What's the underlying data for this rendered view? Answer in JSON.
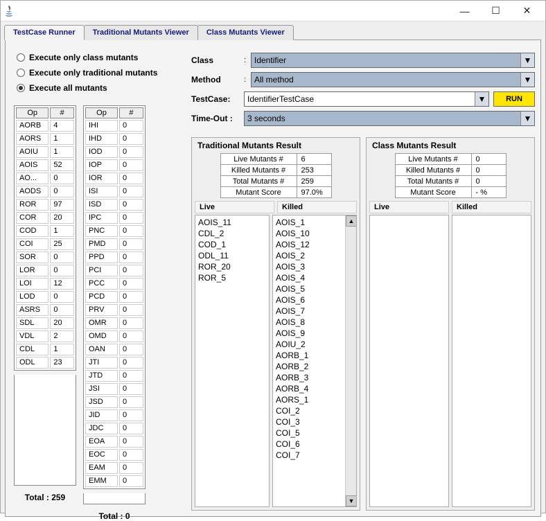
{
  "titlebar": {
    "title": ""
  },
  "tabs": [
    {
      "label": "TestCase Runner",
      "active": true
    },
    {
      "label": "Traditional Mutants Viewer",
      "active": false
    },
    {
      "label": "Class Mutants Viewer",
      "active": false
    }
  ],
  "radios": [
    {
      "label": "Execute only class mutants",
      "checked": false
    },
    {
      "label": "Execute only traditional mutants",
      "checked": false
    },
    {
      "label": "Execute all mutants",
      "checked": true
    }
  ],
  "form": {
    "class_label": "Class",
    "class_value": "Identifier",
    "method_label": "Method",
    "method_value": "All method",
    "testcase_label": "TestCase:",
    "testcase_value": "IdentifierTestCase",
    "run_label": "RUN",
    "timeout_label": "Time-Out :",
    "timeout_value": "3 seconds"
  },
  "op_header": {
    "op": "Op",
    "num": "#"
  },
  "op_left": [
    {
      "op": "AORB",
      "n": "4"
    },
    {
      "op": "AORS",
      "n": "1"
    },
    {
      "op": "AOIU",
      "n": "1"
    },
    {
      "op": "AOIS",
      "n": "52"
    },
    {
      "op": "AO...",
      "n": "0"
    },
    {
      "op": "AODS",
      "n": "0"
    },
    {
      "op": "ROR",
      "n": "97"
    },
    {
      "op": "COR",
      "n": "20"
    },
    {
      "op": "COD",
      "n": "1"
    },
    {
      "op": "COI",
      "n": "25"
    },
    {
      "op": "SOR",
      "n": "0"
    },
    {
      "op": "LOR",
      "n": "0"
    },
    {
      "op": "LOI",
      "n": "12"
    },
    {
      "op": "LOD",
      "n": "0"
    },
    {
      "op": "ASRS",
      "n": "0"
    },
    {
      "op": "SDL",
      "n": "20"
    },
    {
      "op": "VDL",
      "n": "2"
    },
    {
      "op": "CDL",
      "n": "1"
    },
    {
      "op": "ODL",
      "n": "23"
    }
  ],
  "op_right": [
    {
      "op": "IHI",
      "n": "0"
    },
    {
      "op": "IHD",
      "n": "0"
    },
    {
      "op": "IOD",
      "n": "0"
    },
    {
      "op": "IOP",
      "n": "0"
    },
    {
      "op": "IOR",
      "n": "0"
    },
    {
      "op": "ISI",
      "n": "0"
    },
    {
      "op": "ISD",
      "n": "0"
    },
    {
      "op": "IPC",
      "n": "0"
    },
    {
      "op": "PNC",
      "n": "0"
    },
    {
      "op": "PMD",
      "n": "0"
    },
    {
      "op": "PPD",
      "n": "0"
    },
    {
      "op": "PCI",
      "n": "0"
    },
    {
      "op": "PCC",
      "n": "0"
    },
    {
      "op": "PCD",
      "n": "0"
    },
    {
      "op": "PRV",
      "n": "0"
    },
    {
      "op": "OMR",
      "n": "0"
    },
    {
      "op": "OMD",
      "n": "0"
    },
    {
      "op": "OAN",
      "n": "0"
    },
    {
      "op": "JTI",
      "n": "0"
    },
    {
      "op": "JTD",
      "n": "0"
    },
    {
      "op": "JSI",
      "n": "0"
    },
    {
      "op": "JSD",
      "n": "0"
    },
    {
      "op": "JID",
      "n": "0"
    },
    {
      "op": "JDC",
      "n": "0"
    },
    {
      "op": "EOA",
      "n": "0"
    },
    {
      "op": "EOC",
      "n": "0"
    },
    {
      "op": "EAM",
      "n": "0"
    },
    {
      "op": "EMM",
      "n": "0"
    }
  ],
  "totals": {
    "left": "Total : 259",
    "right": "Total : 0"
  },
  "trad_result": {
    "title": "Traditional Mutants Result",
    "stats": [
      {
        "label": "Live Mutants #",
        "value": "6"
      },
      {
        "label": "Killed Mutants #",
        "value": "253"
      },
      {
        "label": "Total Mutants #",
        "value": "259"
      },
      {
        "label": "Mutant Score",
        "value": "97.0%"
      }
    ],
    "live_header": "Live",
    "killed_header": "Killed",
    "live": [
      "AOIS_11",
      "CDL_2",
      "COD_1",
      "ODL_11",
      "ROR_20",
      "ROR_5"
    ],
    "killed": [
      "AOIS_1",
      "AOIS_10",
      "AOIS_12",
      "AOIS_2",
      "AOIS_3",
      "AOIS_4",
      "AOIS_5",
      "AOIS_6",
      "AOIS_7",
      "AOIS_8",
      "AOIS_9",
      "AOIU_2",
      "AORB_1",
      "AORB_2",
      "AORB_3",
      "AORB_4",
      "AORS_1",
      "COI_2",
      "COI_3",
      "COI_5",
      "COI_6",
      "COI_7"
    ]
  },
  "class_result": {
    "title": "Class Mutants Result",
    "stats": [
      {
        "label": "Live Mutants #",
        "value": "0"
      },
      {
        "label": "Killed Mutants #",
        "value": "0"
      },
      {
        "label": "Total Mutants #",
        "value": "0"
      },
      {
        "label": "Mutant Score",
        "value": "- %"
      }
    ],
    "live_header": "Live",
    "killed_header": "Killed",
    "live": [],
    "killed": []
  }
}
